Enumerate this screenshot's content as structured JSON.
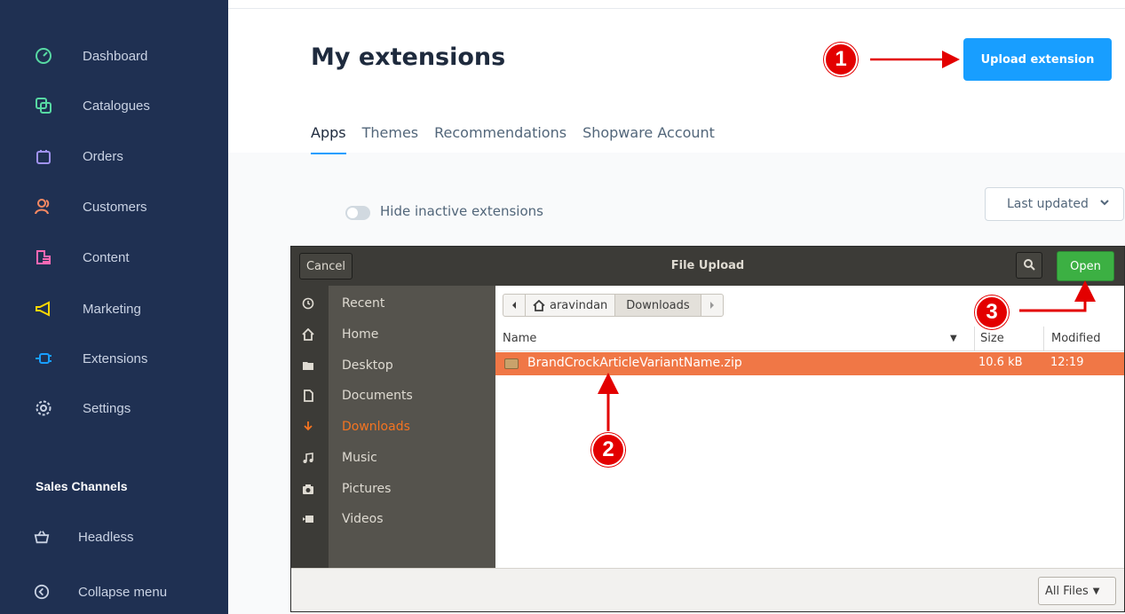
{
  "sidebar": {
    "items": [
      {
        "label": "Dashboard",
        "icon": "gauge-icon"
      },
      {
        "label": "Catalogues",
        "icon": "catalogue-icon"
      },
      {
        "label": "Orders",
        "icon": "shopping-bag-icon"
      },
      {
        "label": "Customers",
        "icon": "users-icon"
      },
      {
        "label": "Content",
        "icon": "content-icon"
      },
      {
        "label": "Marketing",
        "icon": "megaphone-icon"
      },
      {
        "label": "Extensions",
        "icon": "plug-icon"
      },
      {
        "label": "Settings",
        "icon": "gear-icon"
      }
    ],
    "sales_channels_title": "Sales Channels",
    "headless_label": "Headless",
    "collapse_label": "Collapse menu"
  },
  "header": {
    "title": "My extensions",
    "upload_label": "Upload extension"
  },
  "tabs": [
    "Apps",
    "Themes",
    "Recommendations",
    "Shopware Account"
  ],
  "filters": {
    "toggle_label": "Hide inactive extensions",
    "sort_value": "Last updated"
  },
  "dialog": {
    "title": "File Upload",
    "cancel_label": "Cancel",
    "open_label": "Open",
    "places": [
      {
        "label": "Recent",
        "icon": "clock-icon"
      },
      {
        "label": "Home",
        "icon": "home-icon"
      },
      {
        "label": "Desktop",
        "icon": "folder-icon"
      },
      {
        "label": "Documents",
        "icon": "document-icon"
      },
      {
        "label": "Downloads",
        "icon": "download-icon"
      },
      {
        "label": "Music",
        "icon": "music-icon"
      },
      {
        "label": "Pictures",
        "icon": "camera-icon"
      },
      {
        "label": "Videos",
        "icon": "video-icon"
      }
    ],
    "path": [
      "aravindan",
      "Downloads"
    ],
    "columns": {
      "name": "Name",
      "size": "Size",
      "modified": "Modified"
    },
    "file": {
      "name": "BrandCrockArticleVariantName.zip",
      "size": "10.6 kB",
      "modified": "12:19"
    },
    "filter_value": "All Files"
  },
  "annotations": [
    "1",
    "2",
    "3"
  ],
  "colors": {
    "sidebar_bg": "#1f3052",
    "primary": "#189eff",
    "dialog_header": "#3c3b37",
    "selected_row": "#f07746",
    "open_button": "#3cb043",
    "annotation": "#e30000"
  }
}
